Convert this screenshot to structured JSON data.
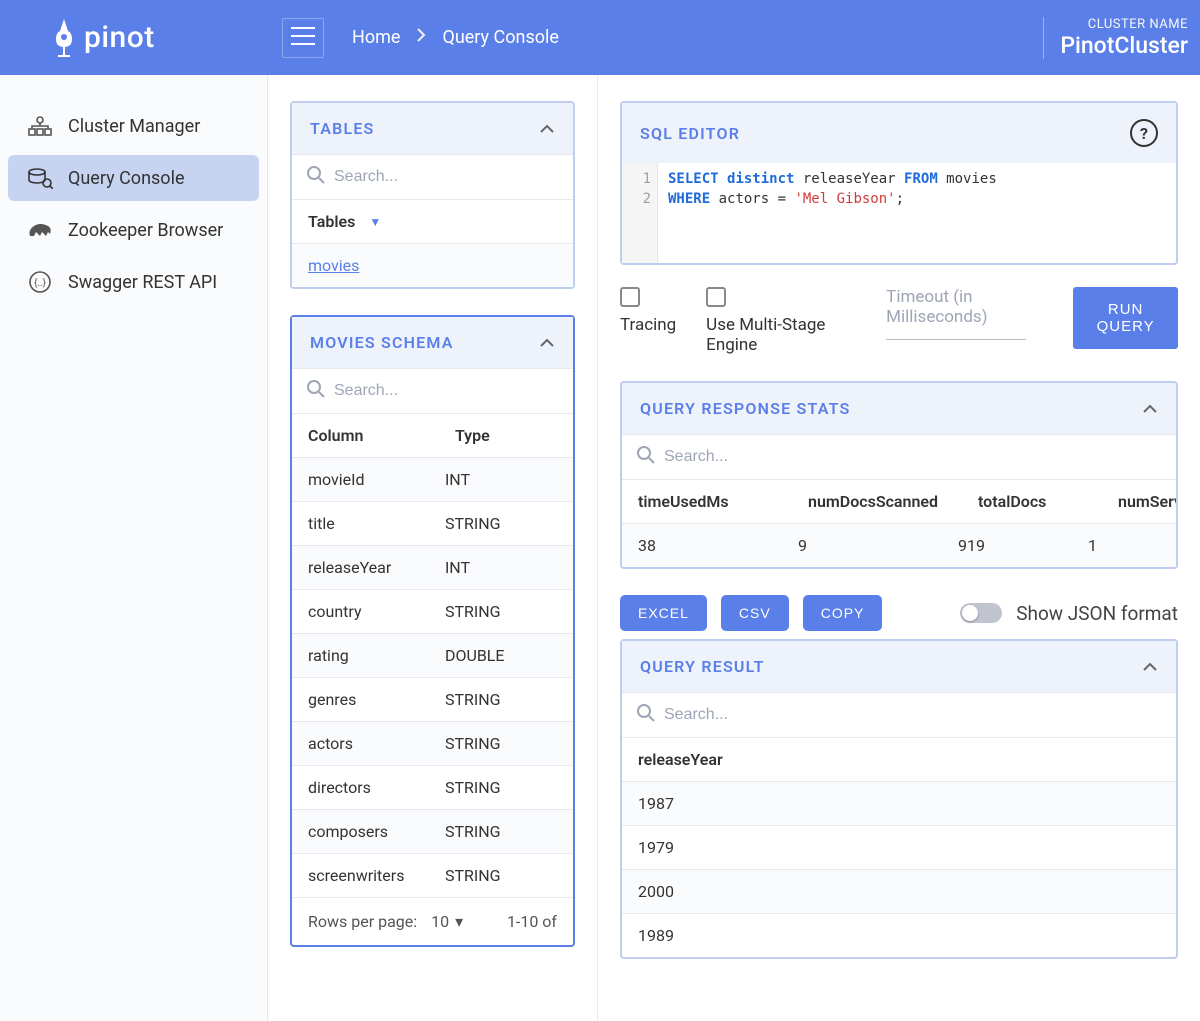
{
  "brand": "pinot",
  "breadcrumbs": {
    "home": "Home",
    "current": "Query Console"
  },
  "cluster": {
    "label": "CLUSTER NAME",
    "name": "PinotCluster"
  },
  "sidebar": {
    "items": [
      {
        "label": "Cluster Manager",
        "icon": "cluster"
      },
      {
        "label": "Query Console",
        "icon": "query"
      },
      {
        "label": "Zookeeper Browser",
        "icon": "zookeeper"
      },
      {
        "label": "Swagger REST API",
        "icon": "swagger"
      }
    ]
  },
  "tablesPanel": {
    "title": "TABLES",
    "searchPlaceholder": "Search...",
    "tablesHeader": "Tables",
    "rows": [
      "movies"
    ]
  },
  "schemaPanel": {
    "title": "MOVIES SCHEMA",
    "searchPlaceholder": "Search...",
    "colHeader": "Column",
    "typeHeader": "Type",
    "rows": [
      {
        "c": "movieId",
        "t": "INT"
      },
      {
        "c": "title",
        "t": "STRING"
      },
      {
        "c": "releaseYear",
        "t": "INT"
      },
      {
        "c": "country",
        "t": "STRING"
      },
      {
        "c": "rating",
        "t": "DOUBLE"
      },
      {
        "c": "genres",
        "t": "STRING"
      },
      {
        "c": "actors",
        "t": "STRING"
      },
      {
        "c": "directors",
        "t": "STRING"
      },
      {
        "c": "composers",
        "t": "STRING"
      },
      {
        "c": "screenwriters",
        "t": "STRING"
      }
    ],
    "rowsPerPageLabel": "Rows per page:",
    "rowsPerPage": "10",
    "range": "1-10 of"
  },
  "sql": {
    "title": "SQL EDITOR",
    "lines": [
      "1",
      "2"
    ],
    "query": {
      "l1": {
        "select": "SELECT",
        "distinct": "distinct",
        "col": " releaseYear ",
        "from": "FROM",
        "tbl": " movies"
      },
      "l2": {
        "where": "WHERE",
        "expr": " actors = ",
        "str": "'Mel Gibson'",
        "end": ";"
      }
    }
  },
  "controls": {
    "tracing": "Tracing",
    "multiStage": "Use Multi-Stage Engine",
    "timeout": "Timeout (in Milliseconds)",
    "run": "RUN QUERY"
  },
  "stats": {
    "title": "QUERY RESPONSE STATS",
    "searchPlaceholder": "Search...",
    "headers": [
      "timeUsedMs",
      "numDocsScanned",
      "totalDocs",
      "numServersQuer"
    ],
    "row": [
      "38",
      "9",
      "919",
      "1"
    ]
  },
  "export": {
    "excel": "EXCEL",
    "csv": "CSV",
    "copy": "COPY",
    "jsonLabel": "Show JSON format"
  },
  "result": {
    "title": "QUERY RESULT",
    "searchPlaceholder": "Search...",
    "header": "releaseYear",
    "rows": [
      "1987",
      "1979",
      "2000",
      "1989"
    ]
  }
}
